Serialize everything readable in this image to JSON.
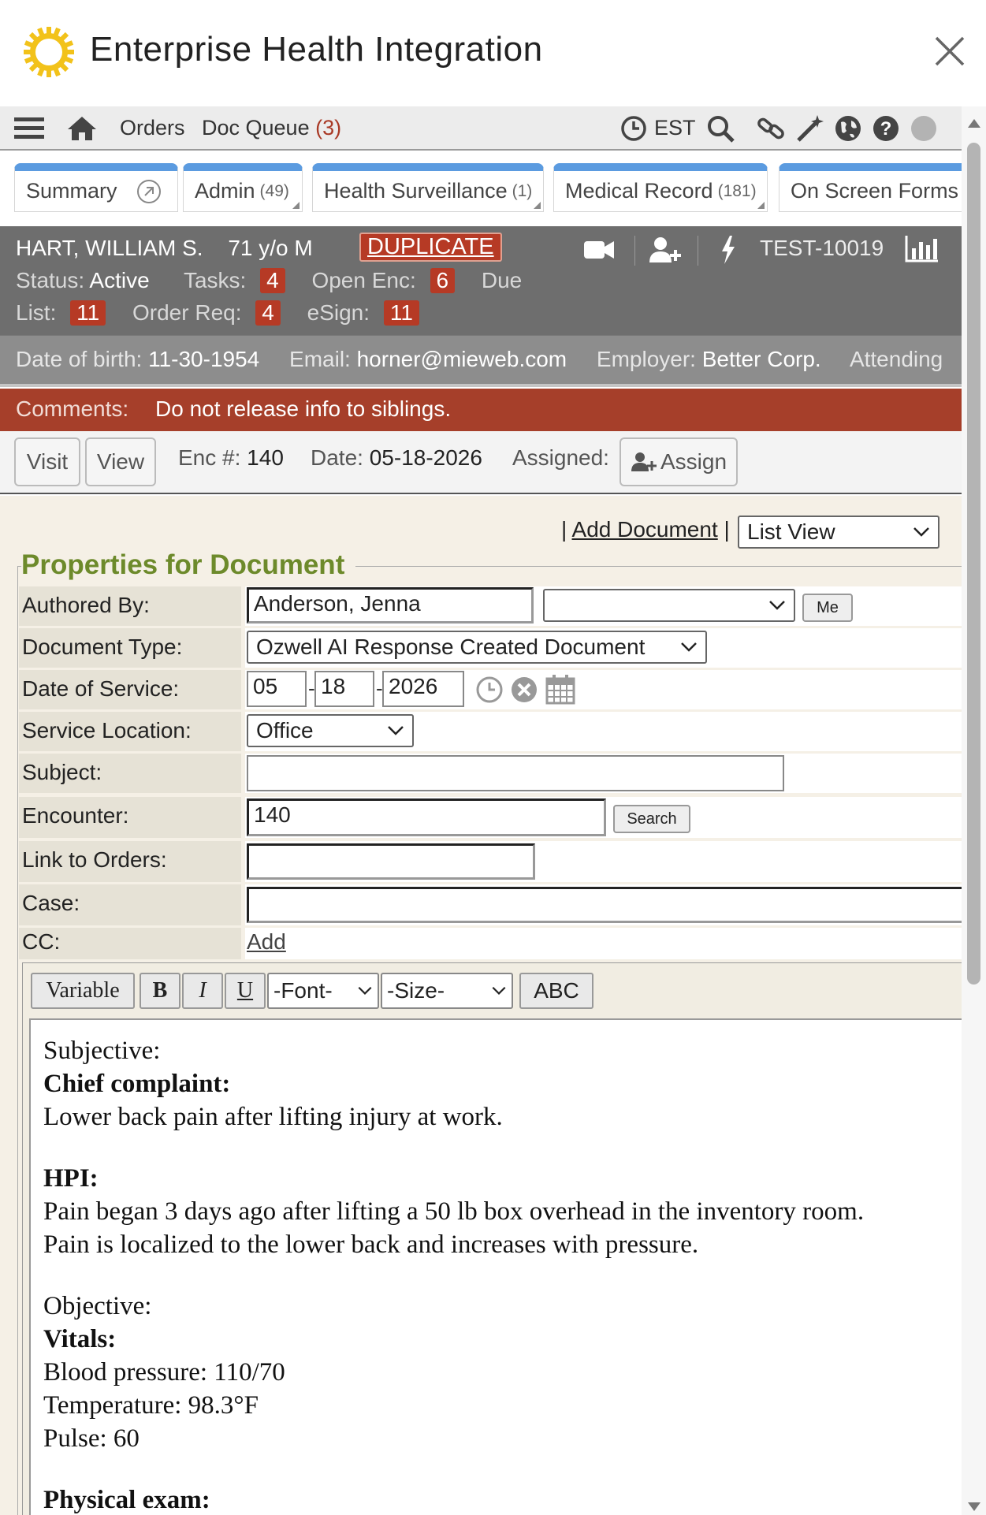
{
  "window": {
    "title": "Enterprise Health Integration"
  },
  "toolbar": {
    "orders": "Orders",
    "doc_queue": "Doc Queue",
    "doc_queue_count": "(3)",
    "timezone": "EST"
  },
  "tabs": [
    {
      "label": "Summary",
      "count": ""
    },
    {
      "label": "Admin",
      "count": "(49)"
    },
    {
      "label": "Health Surveillance",
      "count": "(1)"
    },
    {
      "label": "Medical Record",
      "count": "(181)"
    },
    {
      "label": "On Screen Forms",
      "count": ""
    }
  ],
  "patient": {
    "name": "HART, WILLIAM S.",
    "age_sex": "71 y/o M",
    "duplicate": "DUPLICATE",
    "chart_id": "TEST-10019",
    "status_label": "Status:",
    "status_value": "Active",
    "tasks_label": "Tasks:",
    "tasks": "4",
    "open_enc_label": "Open Enc:",
    "open_enc": "6",
    "due_label": "Due",
    "list_label": "List:",
    "list": "11",
    "order_req_label": "Order Req:",
    "order_req": "4",
    "esign_label": "eSign:",
    "esign": "11",
    "dob_label": "Date of birth:",
    "dob": "11-30-1954",
    "email_label": "Email:",
    "email": "horner@mieweb.com",
    "employer_label": "Employer:",
    "employer": "Better Corp.",
    "attending_label": "Attending"
  },
  "comments": {
    "label": "Comments:",
    "text": "Do not release info to siblings."
  },
  "encounter_bar": {
    "visit": "Visit",
    "view": "View",
    "enc_label": "Enc #:",
    "enc": "140",
    "date_label": "Date:",
    "date": "05-18-2026",
    "assigned_label": "Assigned:",
    "assign": "Assign"
  },
  "doc": {
    "pipe_left": "|",
    "add_document": "Add Document",
    "pipe_right": "|",
    "view_mode": "List View",
    "legend": "Properties for Document"
  },
  "form": {
    "authored_by_label": "Authored By:",
    "authored_by": "Anderson, Jenna",
    "authored_by_select": "",
    "me_button": "Me",
    "doc_type_label": "Document Type:",
    "doc_type": "Ozwell AI Response Created Document",
    "dos_label": "Date of Service:",
    "dos_month": "05",
    "dos_day": "18",
    "dos_year": "2026",
    "location_label": "Service Location:",
    "location": "Office",
    "subject_label": "Subject:",
    "subject": "",
    "encounter_label": "Encounter:",
    "encounter": "140",
    "search_button": "Search",
    "link_orders_label": "Link to Orders:",
    "link_orders": "",
    "case_label": "Case:",
    "case": "",
    "cc_label": "CC:",
    "cc_add": "Add"
  },
  "editor": {
    "variable": "Variable",
    "bold": "B",
    "italic": "I",
    "underline": "U",
    "font": "-Font-",
    "size": "-Size-",
    "spell": "ABC",
    "subjective": "Subjective:",
    "chief_complaint": "Chief complaint:",
    "complaint_text": "Lower back pain after lifting injury at work.",
    "hpi": "HPI:",
    "hpi_line1": "Pain began 3 days ago after lifting a 50 lb box overhead in the inventory room.",
    "hpi_line2": "Pain is localized to the lower back and increases with pressure.",
    "objective": "Objective:",
    "vitals": "Vitals:",
    "bp": "Blood pressure: 110/70",
    "temp": "Temperature: 98.3°F",
    "pulse": "Pulse: 60",
    "physical_exam": "Physical exam:"
  },
  "colors": {
    "tab_accent": "#5b9be0",
    "alert_red": "#a63f2a",
    "legend_green": "#6d8a2b",
    "patient_bg": "#6e6e6e"
  },
  "icons": [
    "logo-icon",
    "close-icon",
    "hamburger-icon",
    "home-icon",
    "clock-icon",
    "search-icon",
    "link-icon",
    "magic-wand-icon",
    "globe-icon",
    "help-icon",
    "status-dot-icon",
    "external-link-icon",
    "video-icon",
    "add-user-icon",
    "lightning-icon",
    "bar-chart-icon",
    "calendar-icon",
    "clear-icon"
  ]
}
